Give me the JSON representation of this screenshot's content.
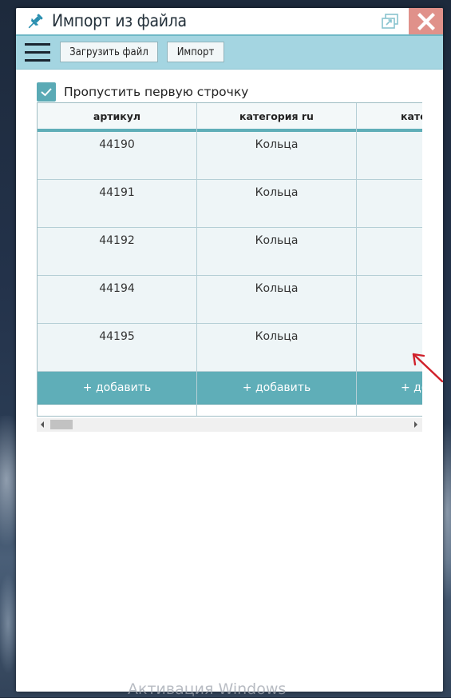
{
  "window": {
    "title": "Импорт из файла",
    "icons": {
      "pin": "pin-icon",
      "popout": "popout-icon",
      "close": "close-icon"
    }
  },
  "toolbar": {
    "menu_icon": "hamburger-icon",
    "upload_label": "Загрузить файл",
    "import_label": "Импорт"
  },
  "options": {
    "skip_first_row": {
      "label": "Пропустить первую строчку",
      "checked": true
    }
  },
  "grid": {
    "columns": [
      "артикул",
      "категория ru",
      "кате"
    ],
    "rows": [
      [
        "44190",
        "Кольца",
        ""
      ],
      [
        "44191",
        "Кольца",
        ""
      ],
      [
        "44192",
        "Кольца",
        ""
      ],
      [
        "44194",
        "Кольца",
        ""
      ],
      [
        "44195",
        "Кольца",
        ""
      ]
    ],
    "add_label": "+ добавить",
    "add_label_cut": "+ до"
  },
  "os": {
    "watermark": "Активация Windows"
  },
  "colors": {
    "accent": "#5faeb8",
    "toolbar": "#a4d5e1",
    "close_button": "#e0918a",
    "annotation_arrow": "#d0202a"
  }
}
